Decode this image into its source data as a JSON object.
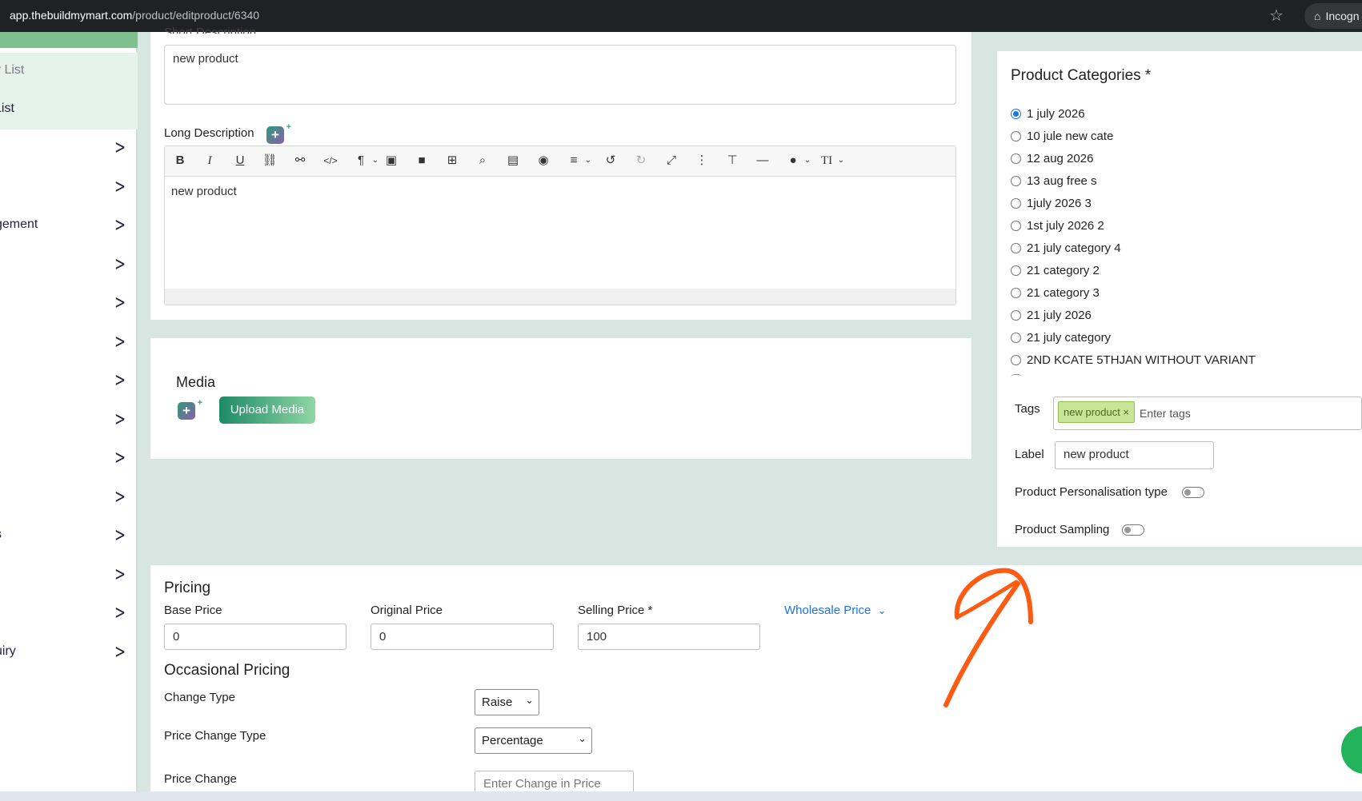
{
  "browser": {
    "domain": "app.thebuildmymart.com",
    "path": "/product/editproduct/6340",
    "incognito_label": "Incogn"
  },
  "sidebar": {
    "sub_items": [
      {
        "label": "y List"
      },
      {
        "label": "List"
      }
    ],
    "items": [
      {
        "label": ""
      },
      {
        "label": ""
      },
      {
        "label": "gement"
      },
      {
        "label": ""
      },
      {
        "label": ""
      },
      {
        "label": ""
      },
      {
        "label": ""
      },
      {
        "label": ""
      },
      {
        "label": ""
      },
      {
        "label": ""
      },
      {
        "label": "s"
      },
      {
        "label": ""
      },
      {
        "label": ""
      },
      {
        "label": "uiry"
      }
    ]
  },
  "short_description": {
    "label": "Short Description",
    "value": "new product"
  },
  "long_description": {
    "label": "Long Description",
    "value": "new product",
    "toolbar": [
      "bold-icon",
      "italic-icon",
      "underline-icon",
      "link-icon",
      "unlink-icon",
      "code-icon",
      "paragraph-icon",
      "image-icon",
      "video-icon",
      "table-icon",
      "search-icon",
      "file-icon",
      "preview-icon",
      "align-icon",
      "undo-icon",
      "redo-icon",
      "fullscreen-icon",
      "more-icon",
      "format-painter-icon",
      "hr-icon",
      "color-icon",
      "text-size-icon"
    ]
  },
  "media": {
    "title": "Media",
    "upload_label": "Upload Media"
  },
  "categories": {
    "title": "Product Categories *",
    "options": [
      {
        "label": "1 july 2026",
        "checked": true
      },
      {
        "label": "10 jule new cate",
        "checked": false
      },
      {
        "label": "12 aug 2026",
        "checked": false
      },
      {
        "label": "13 aug free s",
        "checked": false
      },
      {
        "label": "1july 2026 3",
        "checked": false
      },
      {
        "label": "1st july 2026 2",
        "checked": false
      },
      {
        "label": "21 july category 4",
        "checked": false
      },
      {
        "label": "21 category 2",
        "checked": false
      },
      {
        "label": "21 category 3",
        "checked": false
      },
      {
        "label": "21 july 2026",
        "checked": false
      },
      {
        "label": "21 july category",
        "checked": false
      },
      {
        "label": "2ND KCATE 5THJAN WITHOUT VARIANT",
        "checked": false
      }
    ]
  },
  "tags": {
    "label": "Tags",
    "chip": "new product ×",
    "placeholder": "Enter tags"
  },
  "label_field": {
    "label": "Label",
    "value": "new product"
  },
  "personalisation": {
    "label": "Product Personalisation type"
  },
  "sampling": {
    "label": "Product Sampling"
  },
  "pricing": {
    "title": "Pricing",
    "base_label": "Base Price",
    "base_value": "0",
    "original_label": "Original Price",
    "original_value": "0",
    "selling_label": "Selling Price *",
    "selling_value": "100",
    "wholesale_label": "Wholesale Price"
  },
  "occasional": {
    "title": "Occasional Pricing",
    "change_type_label": "Change Type",
    "change_type_value": "Raise",
    "price_change_type_label": "Price Change Type",
    "price_change_type_value": "Percentage",
    "price_change_label": "Price Change",
    "price_change_placeholder": "Enter Change in Price"
  },
  "colors": {
    "accent": "#1e8a68",
    "annotation": "#ff5a12",
    "link": "#1a73e8"
  }
}
